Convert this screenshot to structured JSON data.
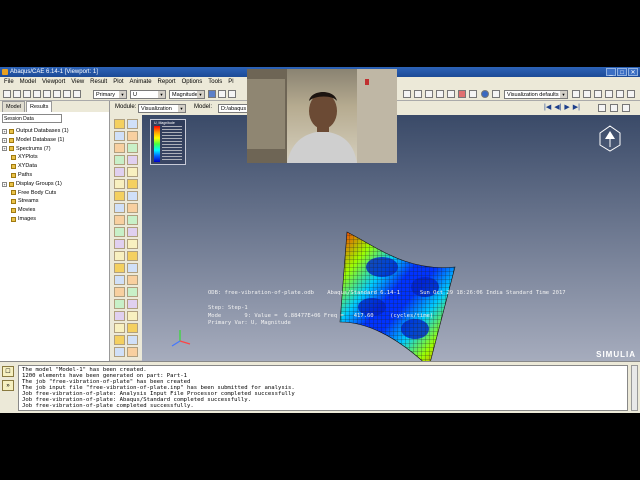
{
  "window": {
    "title": "Abaqus/CAE 6.14-1 [Viewport: 1]",
    "controls": [
      "_",
      "□",
      "✕"
    ]
  },
  "menu": [
    "File",
    "Model",
    "Viewport",
    "View",
    "Result",
    "Plot",
    "Animate",
    "Report",
    "Options",
    "Tools",
    "Pl"
  ],
  "toolbar": {
    "primary_combo": "Primary",
    "variable_combo": "U",
    "component_combo": "Magnitude",
    "view_defaults_combo": "Visualization defaults"
  },
  "module_row": {
    "module_label": "Module:",
    "module_value": "Visualization",
    "model_label": "Model:",
    "model_value": "D:/abaqus",
    "play_controls": [
      "|◀",
      "◀|",
      "▶",
      "▶|"
    ]
  },
  "left_panel": {
    "tabs": [
      "Model",
      "Results"
    ],
    "active_tab": "Results",
    "session": "Session Data",
    "tree": [
      {
        "label": "Output Databases (1)",
        "child": false,
        "expand": "+"
      },
      {
        "label": "Model Database (1)",
        "child": false,
        "expand": "+"
      },
      {
        "label": "Spectrums (7)",
        "child": false,
        "expand": "+"
      },
      {
        "label": "XYPlots",
        "child": true
      },
      {
        "label": "XYData",
        "child": true
      },
      {
        "label": "Paths",
        "child": true
      },
      {
        "label": "Display Groups (1)",
        "child": false,
        "expand": "+"
      },
      {
        "label": "Free Body Cuts",
        "child": true
      },
      {
        "label": "Streams",
        "child": true
      },
      {
        "label": "Movies",
        "child": true
      },
      {
        "label": "Images",
        "child": true
      }
    ]
  },
  "viewport": {
    "legend_title": "U, Magnitude",
    "odb_line": "ODB: free-vibration-of-plate.odb    Abaqus/Standard 6.14-1      Sun Oct 29 18:26:06 India Standard Time 2017",
    "step_line": "Step: Step-1",
    "mode_line": "Mode       9: Value =  6.88477E+06 Freq =   417.60     (cycles/time)",
    "var_line": "Primary Var: U, Magnitude",
    "brand": "SIMULIA",
    "colors": {
      "bg_top": "#3a4a68",
      "bg_bottom": "#a6acbd"
    }
  },
  "messages": [
    "The model \"Model-1\" has been created.",
    "1200 elements have been generated on part: Part-1",
    "The job \"free-vibration-of-plate\" has been created",
    "The job input file \"free-vibration-of-plate.inp\" has been submitted for analysis.",
    "Job free-vibration-of-plate: Analysis Input File Processor completed successfully",
    "Job free-vibration-of-plate: Abaqus/Standard completed successfully.",
    "Job free-vibration-of-plate completed successfully."
  ]
}
